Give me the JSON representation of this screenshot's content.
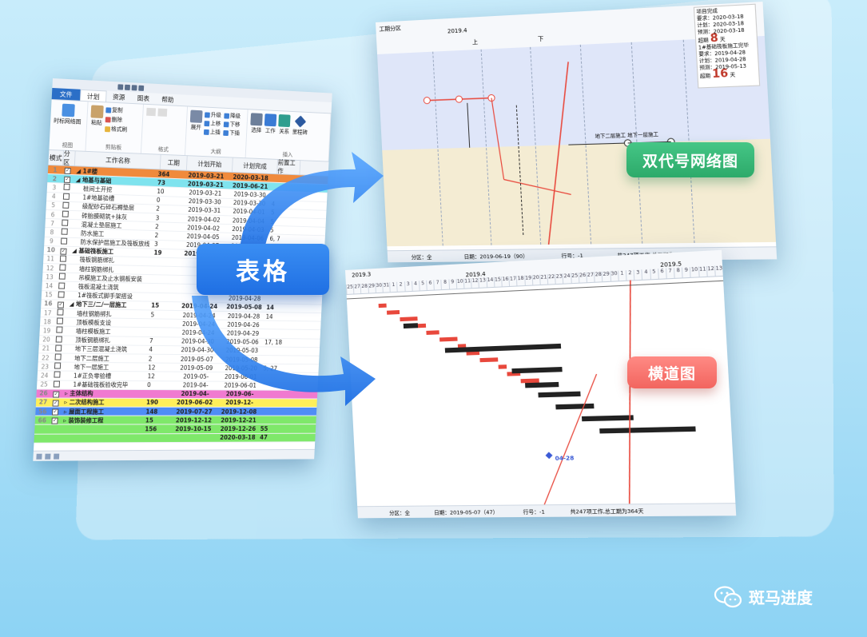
{
  "table": {
    "menu": [
      {
        "label": "文件",
        "cls": "file"
      },
      {
        "label": "计划",
        "cls": "active"
      },
      {
        "label": "资源",
        "cls": ""
      },
      {
        "label": "图表",
        "cls": ""
      },
      {
        "label": "帮助",
        "cls": ""
      }
    ],
    "ribbon": {
      "view_label": "时标网络图",
      "paste_label": "粘贴",
      "copy_label": "复制",
      "delete_label": "删除",
      "format_painter_label": "格式刷",
      "group_view": "视图",
      "group_clipboard": "剪贴板",
      "group_format": "格式",
      "expand_label": "展开",
      "upgrade_label": "升级",
      "downgrade_label": "降级",
      "move_up_label": "上移",
      "move_down_label": "下移",
      "above_label": "上插",
      "below_label": "下插",
      "group_outline": "大纲",
      "select_label": "选择",
      "work_label": "工作",
      "relation_label": "关系",
      "milestone_label": "里程碑",
      "group_insert": "插入"
    },
    "columns": [
      "模式",
      "分区",
      "工作名称",
      "工期",
      "计划开始",
      "计划完成",
      "前置工作"
    ],
    "rows": [
      {
        "n": "1",
        "cb": "on",
        "name": "◢ 1#楼",
        "dur": "364",
        "start": "2019-03-21",
        "end": "2020-03-18",
        "pred": "",
        "bold": true,
        "bg": "#f08a3c"
      },
      {
        "n": "2",
        "cb": "on",
        "name": "◢ 地基与基础",
        "dur": "73",
        "start": "2019-03-21",
        "end": "2019-06-21",
        "pred": "",
        "bold": true,
        "bg": "#7fe3ee"
      },
      {
        "n": "3",
        "cb": "",
        "name": "桩间土开挖",
        "dur": "10",
        "start": "2019-03-21",
        "end": "2019-03-30",
        "pred": "",
        "bold": false,
        "bg": ""
      },
      {
        "n": "4",
        "cb": "",
        "name": "1#地基验槽",
        "dur": "0",
        "start": "2019-03-30",
        "end": "2019-03-30",
        "pred": "4",
        "bold": false,
        "bg": ""
      },
      {
        "n": "5",
        "cb": "",
        "name": "级配砂石碎石褥垫层",
        "dur": "2",
        "start": "2019-03-31",
        "end": "2019-04-01",
        "pred": "5",
        "bold": false,
        "bg": ""
      },
      {
        "n": "6",
        "cb": "",
        "name": "砖胎膜砌筑+抹灰",
        "dur": "3",
        "start": "2019-04-02",
        "end": "2019-04-04",
        "pred": "5",
        "bold": false,
        "bg": ""
      },
      {
        "n": "7",
        "cb": "",
        "name": "混凝土垫层施工",
        "dur": "2",
        "start": "2019-04-02",
        "end": "2019-04-03",
        "pred": "5",
        "bold": false,
        "bg": ""
      },
      {
        "n": "8",
        "cb": "",
        "name": "防水施工",
        "dur": "2",
        "start": "2019-04-05",
        "end": "2019-04-06",
        "pred": "6, 7",
        "bold": false,
        "bg": ""
      },
      {
        "n": "9",
        "cb": "",
        "name": "防水保护层施工及筏板放线",
        "dur": "3",
        "start": "2019-04-07",
        "end": "2019-04-09",
        "pred": "8",
        "bold": false,
        "bg": ""
      },
      {
        "n": "10",
        "cb": "on",
        "name": "◢ 基础筏板施工",
        "dur": "19",
        "start": "2019-04-10",
        "end": "2019-04-28",
        "pred": "",
        "bold": true,
        "bg": ""
      },
      {
        "n": "11",
        "cb": "",
        "name": "筏板钢筋绑扎",
        "dur": "",
        "start": "",
        "end": "2019-04-17",
        "pred": "9",
        "bold": false,
        "bg": ""
      },
      {
        "n": "12",
        "cb": "",
        "name": "墙柱钢筋绑扎",
        "dur": "",
        "start": "",
        "end": "2019-04-20",
        "pred": "",
        "bold": false,
        "bg": ""
      },
      {
        "n": "13",
        "cb": "",
        "name": "吊模施工及止水钢板安装",
        "dur": "",
        "start": "",
        "end": "2019-04-24",
        "pred": "",
        "bold": false,
        "bg": ""
      },
      {
        "n": "14",
        "cb": "",
        "name": "筏板混凝土浇筑",
        "dur": "",
        "start": "",
        "end": "2019-04-26",
        "pred": "",
        "bold": false,
        "bg": ""
      },
      {
        "n": "15",
        "cb": "",
        "name": "1#筏板式脚手架搭设",
        "dur": "",
        "start": "",
        "end": "2019-04-28",
        "pred": "",
        "bold": false,
        "bg": ""
      },
      {
        "n": "16",
        "cb": "on",
        "name": "◢ 地下三/二/一层施工",
        "dur": "15",
        "start": "2019-04-24",
        "end": "2019-05-08",
        "pred": "14",
        "bold": true,
        "bg": ""
      },
      {
        "n": "17",
        "cb": "",
        "name": "墙柱钢筋绑扎",
        "dur": "5",
        "start": "2019-04-24",
        "end": "2019-04-28",
        "pred": "14",
        "bold": false,
        "bg": ""
      },
      {
        "n": "18",
        "cb": "",
        "name": "顶板模板支设",
        "dur": "",
        "start": "2019-04-24",
        "end": "2019-04-26",
        "pred": "",
        "bold": false,
        "bg": ""
      },
      {
        "n": "19",
        "cb": "",
        "name": "墙柱模板施工",
        "dur": "",
        "start": "2019-04-24",
        "end": "2019-04-29",
        "pred": "",
        "bold": false,
        "bg": ""
      },
      {
        "n": "20",
        "cb": "",
        "name": "顶板钢筋绑扎",
        "dur": "7",
        "start": "2019-04-30",
        "end": "2019-05-06",
        "pred": "17, 18",
        "bold": false,
        "bg": ""
      },
      {
        "n": "21",
        "cb": "",
        "name": "地下三层混凝土浇筑",
        "dur": "4",
        "start": "2019-04-30",
        "end": "2019-05-03",
        "pred": "",
        "bold": false,
        "bg": ""
      },
      {
        "n": "22",
        "cb": "",
        "name": "地下二层施工",
        "dur": "2",
        "start": "2019-05-07",
        "end": "2019-05-08",
        "pred": "",
        "bold": false,
        "bg": ""
      },
      {
        "n": "23",
        "cb": "",
        "name": "地下一层施工",
        "dur": "12",
        "start": "2019-05-09",
        "end": "2019-05-20",
        "pred": "5, 27",
        "bold": false,
        "bg": ""
      },
      {
        "n": "24",
        "cb": "",
        "name": "1#正负零验槽",
        "dur": "12",
        "start": "2019-05-",
        "end": "2019-06-01",
        "pred": "",
        "bold": false,
        "bg": ""
      },
      {
        "n": "25",
        "cb": "",
        "name": "1#基础筏板验收完毕",
        "dur": "0",
        "start": "2019-04-",
        "end": "2019-06-01",
        "pred": "",
        "bold": false,
        "bg": ""
      },
      {
        "n": "26",
        "cb": "on",
        "name": "▹ 主体结构",
        "dur": "",
        "start": "2019-04-",
        "end": "2019-06-",
        "pred": "",
        "bold": true,
        "bg": "#f07ad0"
      },
      {
        "n": "27",
        "cb": "on",
        "name": "▹ 二次结构施工",
        "dur": "190",
        "start": "2019-06-02",
        "end": "2019-12-",
        "pred": "",
        "bold": true,
        "bg": "#ffef5a"
      },
      {
        "n": "56",
        "cb": "on",
        "name": "▹ 屋面工程施工",
        "dur": "148",
        "start": "2019-07-27",
        "end": "2019-12-08",
        "pred": "",
        "bold": true,
        "bg": "#4f8df5"
      },
      {
        "n": "66",
        "cb": "on",
        "name": "▹ 装饰装修工程",
        "dur": "15",
        "start": "2019-12-12",
        "end": "2019-12-21",
        "pred": "",
        "bold": true,
        "bg": "#7fe86a"
      },
      {
        "n": "",
        "cb": "",
        "name": "",
        "dur": "156",
        "start": "2019-10-15",
        "end": "2019-12-26",
        "pred": "55",
        "bold": true,
        "bg": "#7fe86a"
      },
      {
        "n": "",
        "cb": "",
        "name": "",
        "dur": "",
        "start": "",
        "end": "2020-03-18",
        "pred": "47",
        "bold": true,
        "bg": "#7fe86a"
      }
    ]
  },
  "network": {
    "header_left": "工期分区",
    "year_label": "2019.4",
    "month_upper": "上",
    "month_lower": "下",
    "info": {
      "title": "项目完成",
      "required": "要求：2020-03-18",
      "plan": "计划：2020-03-18",
      "forecast": "预测：2020-03-18",
      "delay_label": "超期",
      "delay_value": "8",
      "unit": "天",
      "task": "1#基础筏板施工完毕",
      "t_required": "要求：2019-04-28",
      "t_plan": "计划：2019-04-28",
      "t_forecast": "预测：2019-05-13",
      "t_delay_label": "超期",
      "t_delay_value": "16",
      "t_unit": "天"
    },
    "status_left": "分区：全",
    "status_mid": "日期：2019-06-19（90）",
    "status_row": "行号：-1",
    "status_right": "共247项工作,总工期为364天",
    "node_labels": [
      "地下二层施工",
      "地下一层施工"
    ],
    "node_num": "12"
  },
  "gantt": {
    "year_left": "2019.3",
    "year_mid": "2019.4",
    "year_right": "2019.5",
    "days": [
      "25",
      "27",
      "28",
      "29",
      "30",
      "31",
      "1",
      "2",
      "3",
      "4",
      "5",
      "6",
      "7",
      "8",
      "9",
      "10",
      "11",
      "12",
      "13",
      "14",
      "15",
      "16",
      "17",
      "18",
      "19",
      "20",
      "21",
      "22",
      "23",
      "24",
      "25",
      "26",
      "27",
      "28",
      "29",
      "30",
      "1",
      "2",
      "3",
      "4",
      "5",
      "6",
      "7",
      "8",
      "9",
      "10",
      "11",
      "12",
      "13"
    ],
    "milestone_label": "04-28",
    "status_left": "分区：全",
    "status_mid": "日期：2019-05-07（47）",
    "status_row": "行号：-1",
    "status_right": "共247项工作,总工期为364天"
  },
  "overlays": {
    "table_label": "表格",
    "network_label": "双代号网络图",
    "gantt_label": "横道图",
    "brand": "斑马进度"
  },
  "colors": {
    "network_badge": "#2daa6a",
    "gantt_badge": "#f2655f",
    "table_badge": "#1f6fe3",
    "critical": "#e8483c"
  }
}
